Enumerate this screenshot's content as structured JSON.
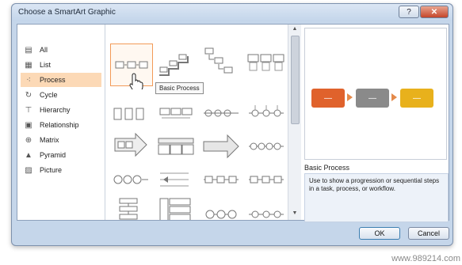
{
  "window": {
    "title": "Choose a SmartArt Graphic",
    "help_label": "?",
    "close_label": "✕"
  },
  "categories": [
    {
      "label": "All",
      "icon": "all-icon"
    },
    {
      "label": "List",
      "icon": "list-icon"
    },
    {
      "label": "Process",
      "icon": "process-icon",
      "selected": true
    },
    {
      "label": "Cycle",
      "icon": "cycle-icon"
    },
    {
      "label": "Hierarchy",
      "icon": "hierarchy-icon"
    },
    {
      "label": "Relationship",
      "icon": "relationship-icon"
    },
    {
      "label": "Matrix",
      "icon": "matrix-icon"
    },
    {
      "label": "Pyramid",
      "icon": "pyramid-icon"
    },
    {
      "label": "Picture",
      "icon": "picture-icon"
    }
  ],
  "tooltip": "Basic Process",
  "preview": {
    "name": "Basic Process",
    "description": "Use to show a progression or sequential steps in a task, process, or workflow.",
    "shape_label": "—",
    "colors": [
      "#e0622c",
      "#8a8a8a",
      "#e8b11c"
    ]
  },
  "buttons": {
    "ok": "OK",
    "cancel": "Cancel"
  },
  "watermark": "www.989214.com"
}
